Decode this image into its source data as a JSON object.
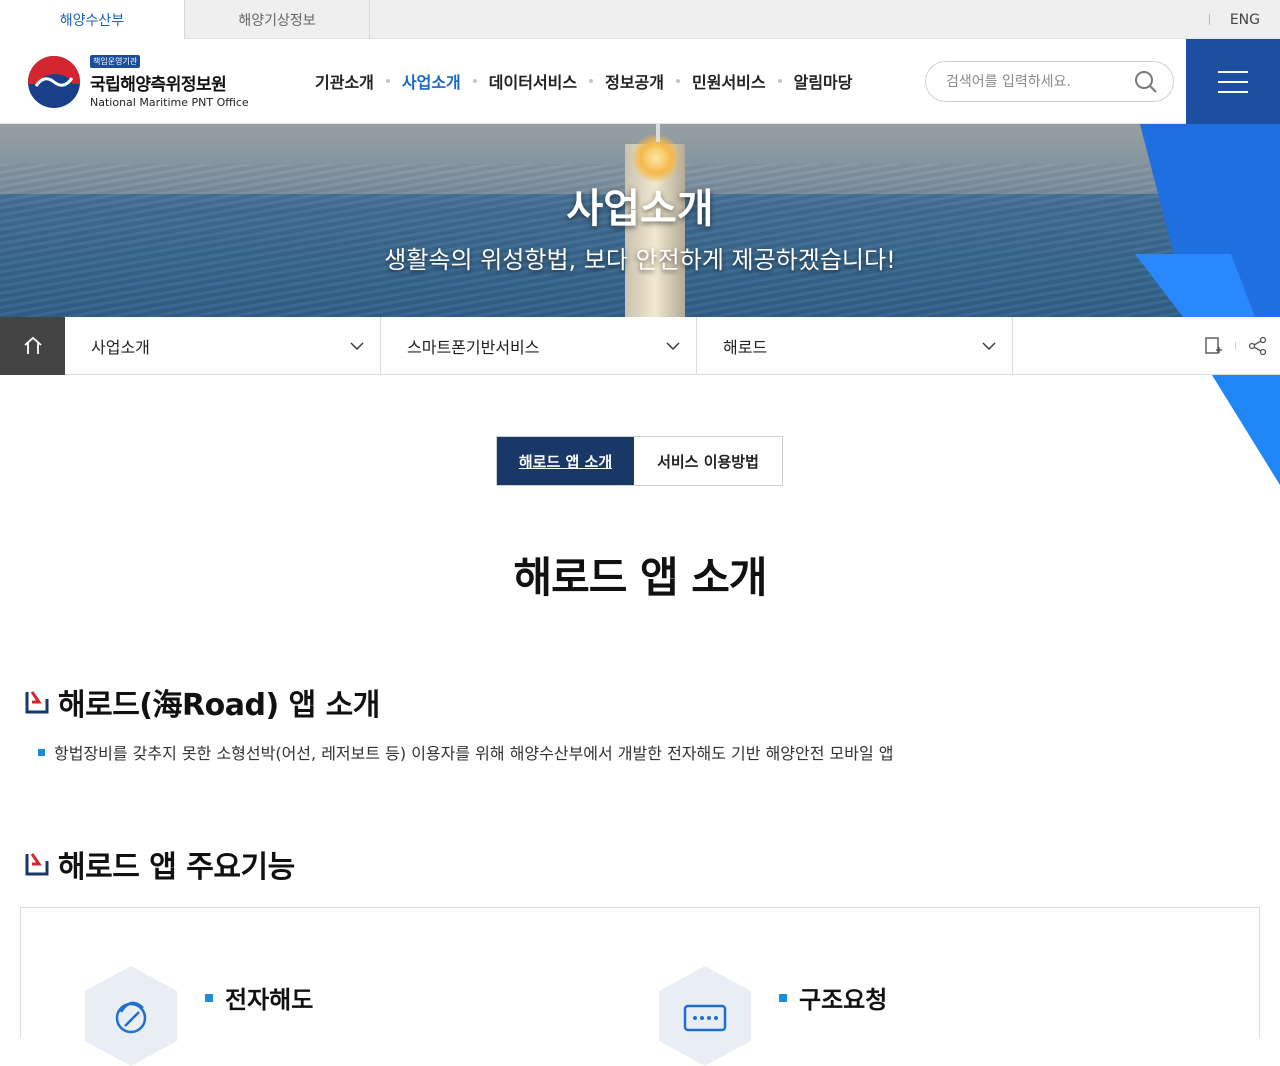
{
  "topbar": {
    "tabs": [
      "해양수산부",
      "해양기상정보"
    ],
    "lang": "ENG"
  },
  "header": {
    "logo_badge": "책임운영기관",
    "logo_ko": "국립해양측위정보원",
    "logo_en": "National Maritime PNT Office",
    "nav": [
      "기관소개",
      "사업소개",
      "데이터서비스",
      "정보공개",
      "민원서비스",
      "알림마당"
    ],
    "nav_active_index": 1,
    "search_placeholder": "검색어를 입력하세요."
  },
  "hero": {
    "title": "사업소개",
    "subtitle": "생활속의 위성항법, 보다 안전하게 제공하겠습니다!"
  },
  "location": {
    "items": [
      "사업소개",
      "스마트폰기반서비스",
      "해로드"
    ]
  },
  "content_tabs": [
    "해로드 앱 소개",
    "서비스 이용방법"
  ],
  "page_title": "해로드 앱 소개",
  "section1": {
    "title": "해로드(海Road) 앱 소개",
    "bullet": "항법장비를 갖추지 못한 소형선박(어선, 레저보트 등) 이용자를 위해 해양수산부에서 개발한 전자해도 기반 해양안전 모바일 앱"
  },
  "section2": {
    "title": "해로드 앱 주요기능",
    "features": [
      "전자해도",
      "구조요청"
    ]
  },
  "colors": {
    "accent_blue": "#1d4fa0",
    "nav_active": "#1a66c6",
    "tab_active": "#1a3867",
    "bullet": "#1a8ed8"
  }
}
